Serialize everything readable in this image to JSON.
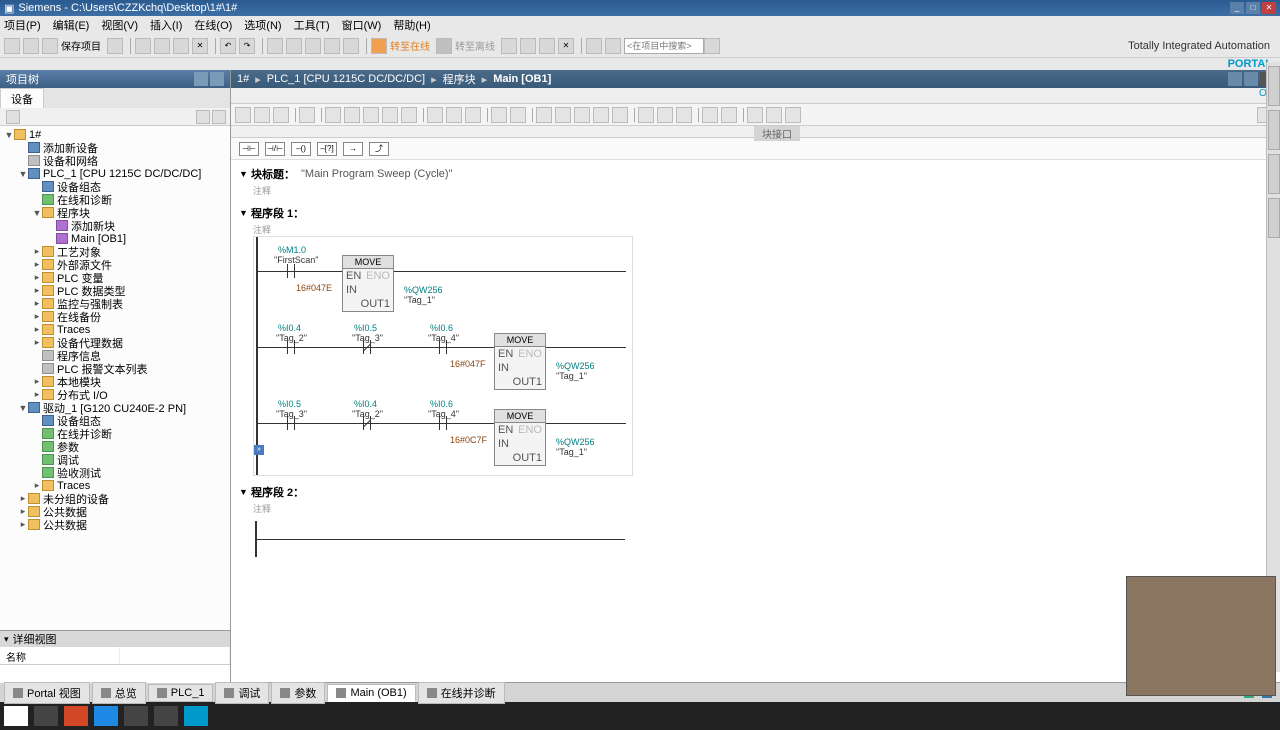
{
  "title": "Siemens  -  C:\\Users\\CZZKchq\\Desktop\\1#\\1#",
  "menu": [
    "项目(P)",
    "编辑(E)",
    "视图(V)",
    "插入(I)",
    "在线(O)",
    "选项(N)",
    "工具(T)",
    "窗口(W)",
    "帮助(H)"
  ],
  "toolbar": {
    "save": "保存项目",
    "search": "<在项目中搜索>"
  },
  "branding": {
    "tia": "Totally Integrated Automation",
    "portal": "PORTAL"
  },
  "left": {
    "header": "项目树",
    "tab": "设备",
    "details": "详细视图",
    "col": "名称"
  },
  "tree": [
    {
      "ind": 0,
      "exp": "▼",
      "ico": "fold",
      "lbl": "1#"
    },
    {
      "ind": 1,
      "exp": "",
      "ico": "dev",
      "lbl": "添加新设备"
    },
    {
      "ind": 1,
      "exp": "",
      "ico": "gry",
      "lbl": "设备和网络"
    },
    {
      "ind": 1,
      "exp": "▼",
      "ico": "dev",
      "lbl": "PLC_1 [CPU 1215C DC/DC/DC]"
    },
    {
      "ind": 2,
      "exp": "",
      "ico": "dev",
      "lbl": "设备组态"
    },
    {
      "ind": 2,
      "exp": "",
      "ico": "grn",
      "lbl": "在线和诊断"
    },
    {
      "ind": 2,
      "exp": "▼",
      "ico": "fold",
      "lbl": "程序块"
    },
    {
      "ind": 3,
      "exp": "",
      "ico": "blk",
      "lbl": "添加新块"
    },
    {
      "ind": 3,
      "exp": "",
      "ico": "blk",
      "lbl": "Main [OB1]"
    },
    {
      "ind": 2,
      "exp": "▸",
      "ico": "fold",
      "lbl": "工艺对象"
    },
    {
      "ind": 2,
      "exp": "▸",
      "ico": "fold",
      "lbl": "外部源文件"
    },
    {
      "ind": 2,
      "exp": "▸",
      "ico": "fold",
      "lbl": "PLC 变量"
    },
    {
      "ind": 2,
      "exp": "▸",
      "ico": "fold",
      "lbl": "PLC 数据类型"
    },
    {
      "ind": 2,
      "exp": "▸",
      "ico": "fold",
      "lbl": "监控与强制表"
    },
    {
      "ind": 2,
      "exp": "▸",
      "ico": "fold",
      "lbl": "在线备份"
    },
    {
      "ind": 2,
      "exp": "▸",
      "ico": "fold",
      "lbl": "Traces"
    },
    {
      "ind": 2,
      "exp": "▸",
      "ico": "fold",
      "lbl": "设备代理数据"
    },
    {
      "ind": 2,
      "exp": "",
      "ico": "gry",
      "lbl": "程序信息"
    },
    {
      "ind": 2,
      "exp": "",
      "ico": "gry",
      "lbl": "PLC 报警文本列表"
    },
    {
      "ind": 2,
      "exp": "▸",
      "ico": "fold",
      "lbl": "本地模块"
    },
    {
      "ind": 2,
      "exp": "▸",
      "ico": "fold",
      "lbl": "分布式 I/O"
    },
    {
      "ind": 1,
      "exp": "▼",
      "ico": "dev",
      "lbl": "驱动_1 [G120 CU240E-2 PN]"
    },
    {
      "ind": 2,
      "exp": "",
      "ico": "dev",
      "lbl": "设备组态"
    },
    {
      "ind": 2,
      "exp": "",
      "ico": "grn",
      "lbl": "在线并诊断"
    },
    {
      "ind": 2,
      "exp": "",
      "ico": "grn",
      "lbl": "参数"
    },
    {
      "ind": 2,
      "exp": "",
      "ico": "grn",
      "lbl": "调试"
    },
    {
      "ind": 2,
      "exp": "",
      "ico": "grn",
      "lbl": "验收测试"
    },
    {
      "ind": 2,
      "exp": "▸",
      "ico": "fold",
      "lbl": "Traces"
    },
    {
      "ind": 1,
      "exp": "▸",
      "ico": "fold",
      "lbl": "未分组的设备"
    },
    {
      "ind": 1,
      "exp": "▸",
      "ico": "fold",
      "lbl": "公共数据"
    },
    {
      "ind": 1,
      "exp": "▸",
      "ico": "fold",
      "lbl": "公共数据"
    }
  ],
  "bc": [
    "1#",
    "PLC_1 [CPU 1215C DC/DC/DC]",
    "程序块",
    "Main [OB1]"
  ],
  "ed_sub_rt": "ON",
  "drawer": "块接口",
  "instr": [
    "⊣⊢",
    "⊣/⊢",
    "–()",
    "–[?]",
    "→",
    "⤴"
  ],
  "block": {
    "label": "块标题：",
    "value": "\"Main Program Sweep (Cycle)\"",
    "comment": "注释"
  },
  "net1": {
    "title": "程序段 1：",
    "comment": "注释"
  },
  "net2": {
    "title": "程序段 2：",
    "comment": "注释"
  },
  "lad": {
    "r1": {
      "c1_addr": "%M1.0",
      "c1_tag": "\"FirstScan\"",
      "box": "MOVE",
      "en": "EN",
      "eno": "ENO",
      "in": "IN",
      "out": "OUT1",
      "in_v": "16#047E",
      "o_addr": "%QW256",
      "o_tag": "\"Tag_1\""
    },
    "r2": {
      "c1_addr": "%I0.4",
      "c1_tag": "\"Tag_2\"",
      "c2_addr": "%I0.5",
      "c2_tag": "\"Tag_3\"",
      "c3_addr": "%I0.6",
      "c3_tag": "\"Tag_4\"",
      "box": "MOVE",
      "in_v": "16#047F",
      "o_addr": "%QW256",
      "o_tag": "\"Tag_1\""
    },
    "r3": {
      "c1_addr": "%I0.5",
      "c1_tag": "\"Tag_3\"",
      "c2_addr": "%I0.4",
      "c2_tag": "\"Tag_2\"",
      "c3_addr": "%I0.6",
      "c3_tag": "\"Tag_4\"",
      "box": "MOVE",
      "in_v": "16#0C7F",
      "o_addr": "%QW256",
      "o_tag": "\"Tag_1\""
    }
  },
  "status": {
    "portal": "Portal 视图",
    "items": [
      "总览",
      "PLC_1",
      "调试",
      "参数",
      "Main (OB1)",
      "在线并诊断"
    ]
  }
}
